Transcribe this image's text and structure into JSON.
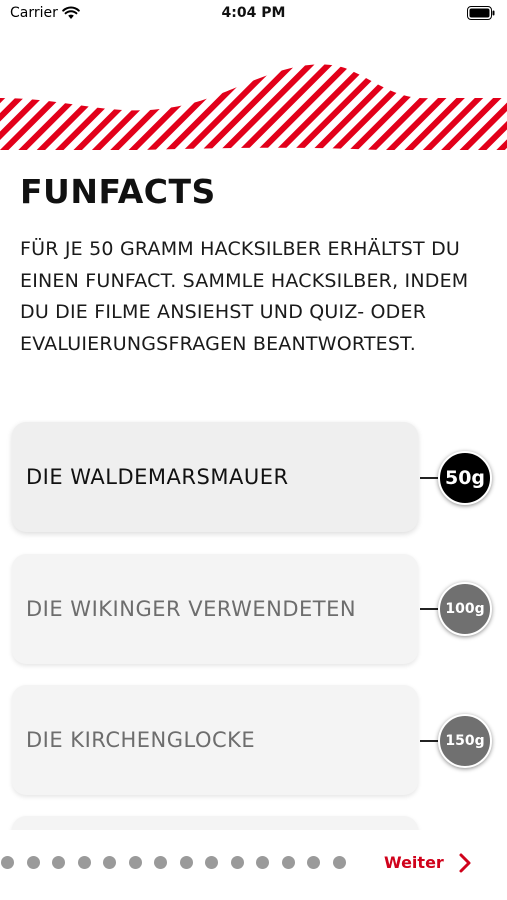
{
  "status_bar": {
    "carrier": "Carrier",
    "time": "4:04 PM"
  },
  "header": {
    "title": "FUNFACTS",
    "intro": "FÜR JE 50 GRAMM HACKSILBER ERHÄLTST DU EINEN FUNFACT. SAMMLE HACKSILBER, INDEM DU DIE FILME ANSIEHST UND QUIZ- ODER EVALUIERUNGSFRAGEN BEANTWORTEST."
  },
  "funfacts": [
    {
      "label": "DIE WALDEMARSMAUER",
      "cost": "50g",
      "active": true
    },
    {
      "label": "DIE WIKINGER VERWENDETEN",
      "cost": "100g",
      "active": false
    },
    {
      "label": "DIE KIRCHENGLOCKE",
      "cost": "150g",
      "active": false
    }
  ],
  "pagination": {
    "total": 14,
    "current": 0
  },
  "footer": {
    "next_label": "Weiter"
  },
  "colors": {
    "accent": "#d0021b",
    "badge_active": "#000000",
    "badge_inactive": "#707070",
    "card_bg": "#f4f4f4"
  },
  "icons": {
    "wifi": "wifi-icon",
    "battery": "battery-icon",
    "next": "chevron-right-icon"
  }
}
